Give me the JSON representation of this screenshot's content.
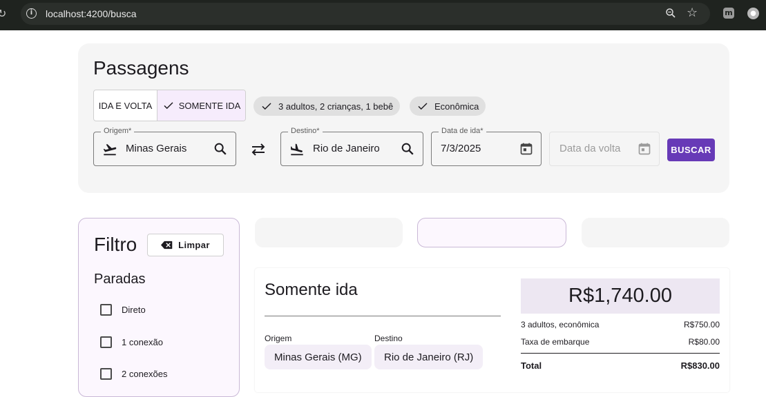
{
  "browser": {
    "url": "localhost:4200/busca",
    "extension_letter": "m"
  },
  "search": {
    "title": "Passagens",
    "trip_type": {
      "round_trip_label": "IDA E VOLTA",
      "one_way_label": "SOMENTE IDA",
      "selected": "SOMENTE IDA"
    },
    "passengers_chip": "3 adultos, 2 crianças, 1 bebê",
    "class_chip": "Econômica",
    "origin": {
      "label": "Origem*",
      "value": "Minas Gerais"
    },
    "destination": {
      "label": "Destino*",
      "value": "Rio de Janeiro"
    },
    "departure_date": {
      "label": "Data de ida*",
      "value": "7/3/2025"
    },
    "return_date": {
      "placeholder": "Data da volta"
    },
    "search_button": "BUSCAR"
  },
  "filter": {
    "title": "Filtro",
    "clear_button": "Limpar",
    "stops_title": "Paradas",
    "options": [
      {
        "label": "Direto",
        "checked": false
      },
      {
        "label": "1 conexão",
        "checked": false
      },
      {
        "label": "2 conexões",
        "checked": false
      }
    ]
  },
  "result": {
    "title": "Somente ida",
    "origin_label": "Origem",
    "origin_value": "Minas Gerais (MG)",
    "destination_label": "Destino",
    "destination_value": "Rio de Janeiro (RJ)",
    "price_total_big": "R$1,740.00",
    "breakdown": {
      "passengers_label": "3 adultos, econômica",
      "passengers_value": "R$750.00",
      "tax_label": "Taxa de embarque",
      "tax_value": "R$80.00",
      "total_label": "Total",
      "total_value": "R$830.00"
    }
  },
  "colors": {
    "accent": "#673ab7",
    "card_bg": "#f5f5f5",
    "selected_bg": "#f6ecfc",
    "price_bg": "#ede7f2"
  }
}
